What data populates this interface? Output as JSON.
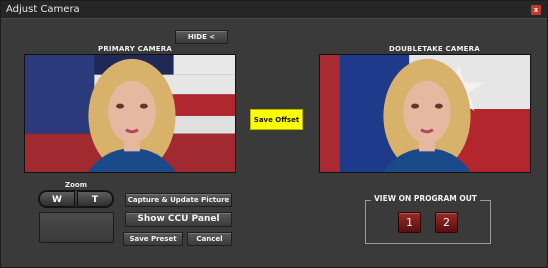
{
  "window": {
    "title": "Adjust Camera",
    "close_glyph": "x"
  },
  "toolbar": {
    "hide_label": "HIDE <"
  },
  "primary": {
    "label": "PRIMARY CAMERA"
  },
  "doubletake": {
    "label": "DOUBLETAKE CAMERA"
  },
  "offset": {
    "save_label": "Save Offset",
    "color": "#ffff00"
  },
  "zoom": {
    "label": "Zoom",
    "wide_label": "W",
    "tele_label": "T"
  },
  "actions": {
    "capture_label": "Capture & Update Picture",
    "ccu_label": "Show CCU Panel",
    "save_preset_label": "Save Preset",
    "cancel_label": "Cancel"
  },
  "program_out": {
    "label": "VIEW ON PROGRAM OUT",
    "buttons": [
      "1",
      "2"
    ],
    "button_color": "#8b1c1c"
  }
}
